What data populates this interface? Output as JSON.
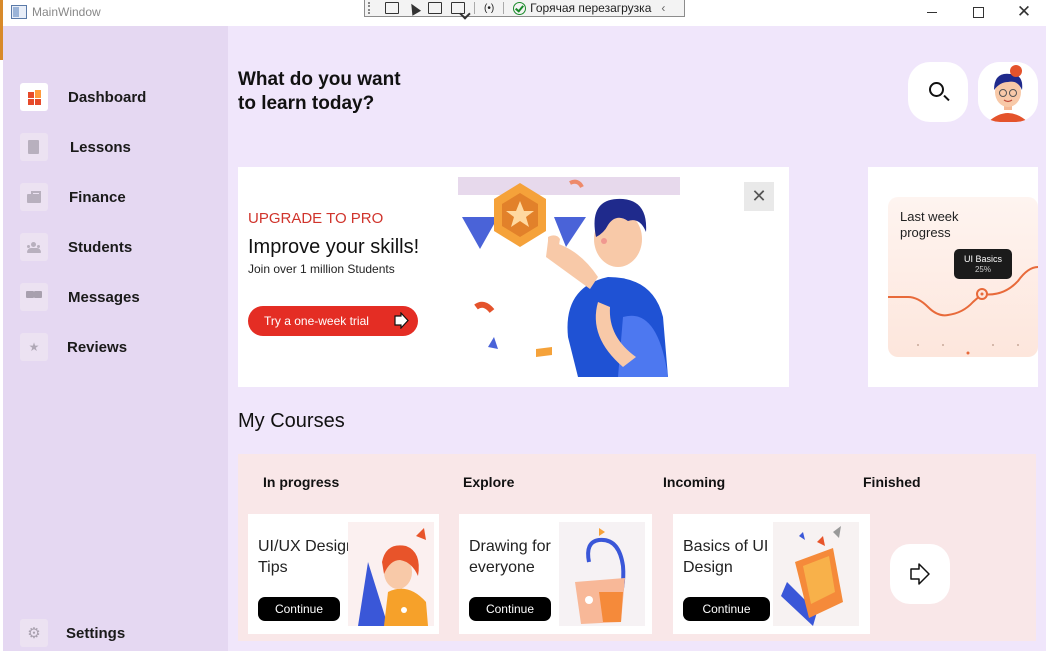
{
  "window": {
    "title": "MainWindow",
    "debug_toolbar": {
      "hot_reload_label": "Горячая перезагрузка",
      "collapse_icon": "chevron-left-icon"
    },
    "controls": {
      "close_glyph": "✕"
    }
  },
  "sidebar": {
    "items": [
      {
        "label": "Dashboard",
        "icon": "dashboard-icon",
        "active": true
      },
      {
        "label": "Lessons",
        "icon": "book-icon"
      },
      {
        "label": "Finance",
        "icon": "briefcase-icon"
      },
      {
        "label": "Students",
        "icon": "people-icon"
      },
      {
        "label": "Messages",
        "icon": "chat-icon"
      },
      {
        "label": "Reviews",
        "icon": "stars-icon"
      }
    ],
    "settings": {
      "label": "Settings",
      "icon": "gear-icon"
    }
  },
  "header": {
    "headline_line1": "What do you want",
    "headline_line2": "to learn today?",
    "search_icon": "search-icon",
    "avatar_icon": "user-avatar"
  },
  "promo": {
    "eyebrow": "UPGRADE TO PRO",
    "title": "Improve your skills!",
    "subtitle": "Join over 1 million Students",
    "cta": "Try a one-week trial",
    "close_glyph": "✕"
  },
  "progress_card": {
    "title": "Last week progress",
    "tooltip_title": "UI Basics",
    "tooltip_value": "25%"
  },
  "courses": {
    "section_title": "My Courses",
    "tabs": [
      "In progress",
      "Explore",
      "Incoming",
      "Finished"
    ],
    "cards": [
      {
        "title": "UI/UX Design Tips",
        "button": "Continue"
      },
      {
        "title": "Drawing for everyone",
        "button": "Continue"
      },
      {
        "title": "Basics of UI Design",
        "button": "Continue"
      }
    ],
    "next_icon": "arrow-right-icon"
  },
  "colors": {
    "sidebar_bg": "#e5d8f2",
    "main_bg": "#f0e6fb",
    "accent_red": "#e42d24",
    "courses_bg": "#f9e7e8"
  }
}
